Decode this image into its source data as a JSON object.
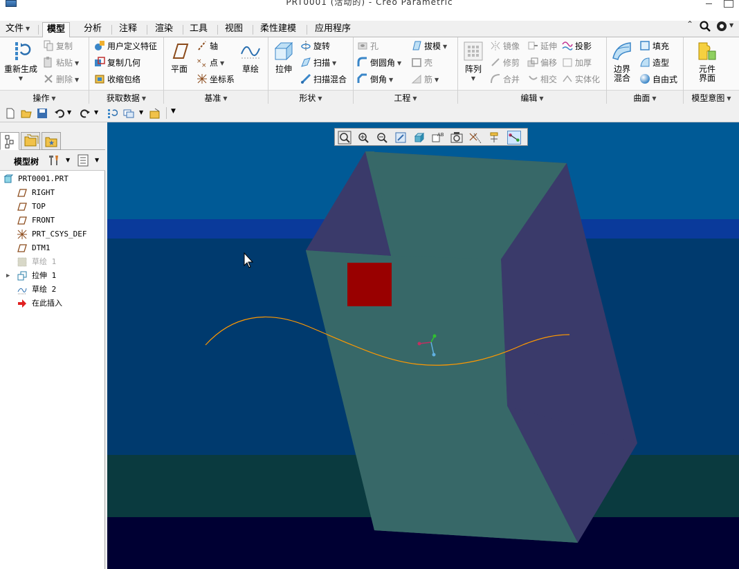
{
  "window": {
    "title": "PRT0001 (活动的) - Creo Parametric"
  },
  "menu_tabs": [
    {
      "label": "文件",
      "active": false
    },
    {
      "label": "模型",
      "active": true
    },
    {
      "label": "分析",
      "active": false
    },
    {
      "label": "注释",
      "active": false
    },
    {
      "label": "渲染",
      "active": false
    },
    {
      "label": "工具",
      "active": false
    },
    {
      "label": "视图",
      "active": false
    },
    {
      "label": "柔性建模",
      "active": false
    },
    {
      "label": "应用程序",
      "active": false
    }
  ],
  "ribbon": {
    "operations": {
      "group_label": "操作",
      "regenerate": "重新生成",
      "copy": "复制",
      "paste": "粘贴",
      "delete": "删除"
    },
    "get_data": {
      "group_label": "获取数据",
      "user_defined_feature": "用户定义特征",
      "copy_geometry": "复制几何",
      "shrinkwrap": "收缩包络"
    },
    "datum": {
      "group_label": "基准",
      "plane": "平面",
      "axis": "轴",
      "point": "点",
      "csys": "坐标系",
      "sketch": "草绘"
    },
    "shapes": {
      "group_label": "形状",
      "extrude": "拉伸",
      "revolve": "旋转",
      "sweep": "扫描",
      "swept_blend": "扫描混合"
    },
    "engineering": {
      "group_label": "工程",
      "hole": "孔",
      "round": "倒圆角",
      "chamfer": "倒角",
      "draft": "拔模",
      "shell": "壳",
      "rib": "筋"
    },
    "editing": {
      "group_label": "编辑",
      "pattern": "阵列",
      "mirror": "镜像",
      "trim": "修剪",
      "merge": "合并",
      "extend": "延伸",
      "offset": "偏移",
      "intersect": "相交",
      "project": "投影",
      "thicken": "加厚",
      "solidify": "实体化"
    },
    "surfaces": {
      "group_label": "曲面",
      "boundary_blend": "边界\n混合",
      "boundary_blend_l1": "边界",
      "boundary_blend_l2": "混合",
      "fill": "填充",
      "style": "造型",
      "freestyle": "自由式"
    },
    "model_intent": {
      "group_label": "模型意图",
      "component_interface_l1": "元件",
      "component_interface_l2": "界面"
    }
  },
  "model_tree": {
    "header_label": "模型树",
    "items": [
      {
        "label": "PRT0001.PRT",
        "icon": "part-icon",
        "indent": 0,
        "disabled": false
      },
      {
        "label": "RIGHT",
        "icon": "datum-plane-icon",
        "indent": 1,
        "disabled": false
      },
      {
        "label": "TOP",
        "icon": "datum-plane-icon",
        "indent": 1,
        "disabled": false
      },
      {
        "label": "FRONT",
        "icon": "datum-plane-icon",
        "indent": 1,
        "disabled": false
      },
      {
        "label": "PRT_CSYS_DEF",
        "icon": "csys-icon",
        "indent": 1,
        "disabled": false
      },
      {
        "label": "DTM1",
        "icon": "datum-plane-icon",
        "indent": 1,
        "disabled": false
      },
      {
        "label": "草绘 1",
        "icon": "sketch-icon",
        "indent": 1,
        "disabled": true
      },
      {
        "label": "拉伸 1",
        "icon": "extrude-icon",
        "indent": 1,
        "disabled": false,
        "expandable": true
      },
      {
        "label": "草绘 2",
        "icon": "sketch-icon",
        "indent": 1,
        "disabled": false
      },
      {
        "label": "在此插入",
        "icon": "insert-here-arrow-icon",
        "indent": 1,
        "disabled": false
      }
    ]
  },
  "colors": {
    "viewport_bg_top": "#005a96",
    "viewport_band": "#0a3a9b",
    "viewport_mid": "#003a6e",
    "viewport_lower": "#0a3a3f",
    "viewport_bottom": "#000033",
    "face_front": "#376868",
    "face_side": "#3a3a6a",
    "red_feature": "#990000",
    "curve": "#ff9900"
  }
}
